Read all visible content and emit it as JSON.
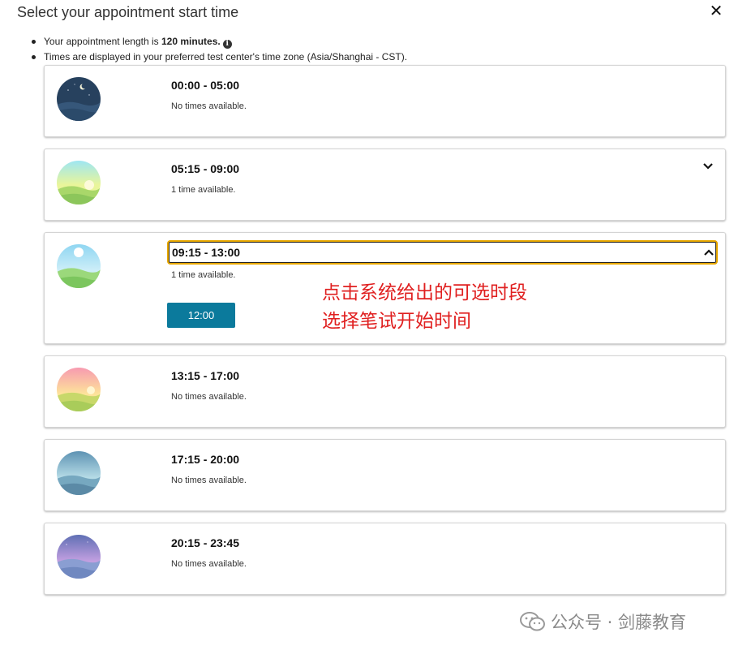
{
  "dialog": {
    "title": "Select your appointment start time",
    "close_glyph": "✕"
  },
  "info": {
    "length_prefix": "Your appointment length is ",
    "length_value": "120 minutes.",
    "info_icon_glyph": "i",
    "timezone_text": "Times are displayed in your preferred test center's time zone (Asia/Shanghai - CST)."
  },
  "slots": [
    {
      "range": "00:00 - 05:00",
      "status": "No times available.",
      "icon": "night-scene-icon"
    },
    {
      "range": "05:15 - 09:00",
      "status": "1 time available.",
      "icon": "dawn-scene-icon",
      "expanded": false
    },
    {
      "range": "09:15 - 13:00",
      "status": "1 time available.",
      "icon": "morning-scene-icon",
      "expanded": true,
      "times": [
        "12:00"
      ]
    },
    {
      "range": "13:15 - 17:00",
      "status": "No times available.",
      "icon": "afternoon-scene-icon"
    },
    {
      "range": "17:15 - 20:00",
      "status": "No times available.",
      "icon": "evening-scene-icon"
    },
    {
      "range": "20:15 - 23:45",
      "status": "No times available.",
      "icon": "dusk-scene-icon"
    }
  ],
  "annotation": {
    "line1": "点击系统给出的可选时段",
    "line2": "选择笔试开始时间",
    "color": "#e02020"
  },
  "watermark": {
    "text": "公众号 · 剑藤教育",
    "icon": "wechat-icon"
  },
  "colors": {
    "primary_button": "#0b7a9c",
    "focus_ring": "#e8a800"
  }
}
